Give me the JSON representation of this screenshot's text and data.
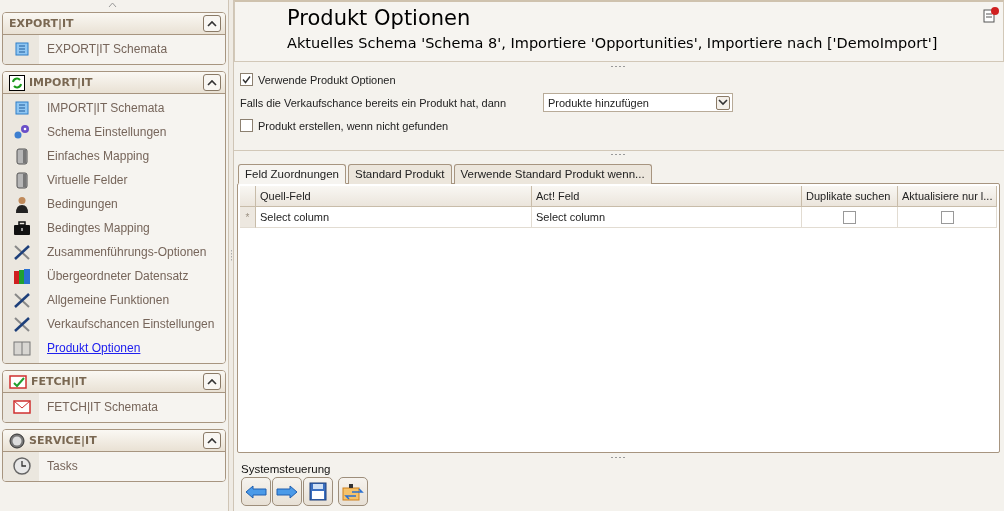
{
  "sidebar": {
    "groups": [
      {
        "title": "EXPORT|IT",
        "expanded": true,
        "items": [
          {
            "label": "EXPORT|IT Schemata",
            "selected": false
          }
        ]
      },
      {
        "title": "IMPORT|IT",
        "expanded": true,
        "items": [
          {
            "label": "IMPORT|IT Schemata",
            "selected": false
          },
          {
            "label": "Schema Einstellungen",
            "selected": false
          },
          {
            "label": "Einfaches Mapping",
            "selected": false
          },
          {
            "label": "Virtuelle Felder",
            "selected": false
          },
          {
            "label": "Bedingungen",
            "selected": false
          },
          {
            "label": "Bedingtes Mapping",
            "selected": false
          },
          {
            "label": "Zusammenführungs-Optionen",
            "selected": false
          },
          {
            "label": "Übergeordneter Datensatz",
            "selected": false
          },
          {
            "label": "Allgemeine Funktionen",
            "selected": false
          },
          {
            "label": "Verkaufschancen Einstellungen",
            "selected": false
          },
          {
            "label": "Produkt Optionen",
            "selected": true
          }
        ]
      },
      {
        "title": "FETCH|IT",
        "expanded": true,
        "items": [
          {
            "label": "FETCH|IT Schemata",
            "selected": false
          }
        ]
      },
      {
        "title": "SERVICE|IT",
        "expanded": true,
        "items": [
          {
            "label": "Tasks",
            "selected": false
          }
        ]
      }
    ]
  },
  "header": {
    "title": "Produkt Optionen",
    "subtitle": "Aktuelles Schema 'Schema 8', Importiere 'Opportunities', Importiere nach ['DemoImport']"
  },
  "options": {
    "use_product_options": {
      "label": "Verwende Produkt Optionen",
      "checked": true
    },
    "existing_product": {
      "label": "Falls die Verkaufschance bereits ein Produkt hat, dann",
      "value": "Produkte hinzufügen"
    },
    "create_product": {
      "label": "Produkt erstellen, wenn nicht gefunden",
      "checked": false
    }
  },
  "tabs": [
    {
      "label": "Feld Zuordnungen",
      "selected": true
    },
    {
      "label": "Standard Produkt",
      "selected": false
    },
    {
      "label": "Verwende Standard Produkt wenn...",
      "selected": false
    }
  ],
  "table": {
    "columns": [
      {
        "label": "Quell-Feld",
        "kind": "text"
      },
      {
        "label": "Act! Feld",
        "kind": "text"
      },
      {
        "label": "Duplikate suchen",
        "kind": "check"
      },
      {
        "label": "Aktualisiere nur l...",
        "kind": "check"
      }
    ],
    "rows": [
      {
        "marker": "*",
        "cells": [
          {
            "text": "Select column"
          },
          {
            "text": "Select column"
          },
          {
            "checked": false
          },
          {
            "checked": false
          }
        ]
      }
    ]
  },
  "system_bar": {
    "title": "Systemsteuerung"
  }
}
